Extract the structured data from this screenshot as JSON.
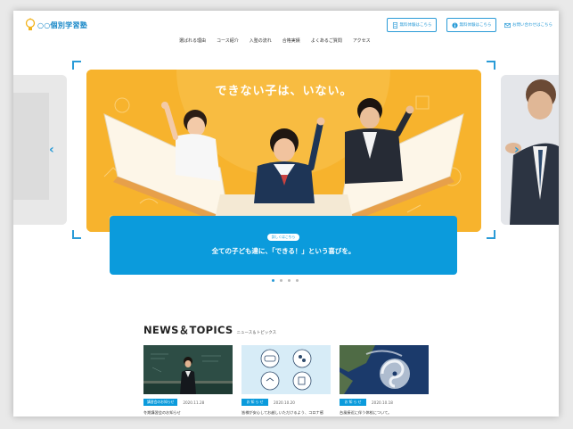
{
  "header": {
    "logo_text": "○○個別学習塾",
    "trial_button": "無料体験はこちら",
    "consult_button": "無料体験はこちら",
    "contact_link": "お問い合わせはこちら"
  },
  "nav": [
    {
      "label": "選ばれる理由"
    },
    {
      "label": "コース紹介"
    },
    {
      "label": "入塾の流れ"
    },
    {
      "label": "合格実績"
    },
    {
      "label": "よくあるご質問"
    },
    {
      "label": "アクセス"
    }
  ],
  "hero": {
    "headline": "できない子は、いない。",
    "pill": "詳しくはこちら",
    "caption": "全ての子ども達に、「できる！」という喜びを。"
  },
  "slider": {
    "dot_count": 4,
    "active_index": 0
  },
  "news": {
    "title": "NEWS＆TOPICS",
    "subtitle": "ニュース＆トピックス",
    "cards": [
      {
        "category": "講習会のお知らせ",
        "date": "2020.11.28",
        "title": "冬期講習会のお知らせ"
      },
      {
        "category": "お 知 ら せ",
        "date": "2020.10.20",
        "title": "皆様が安心してお越しいただけるよう、コロナ感"
      },
      {
        "category": "お 知 ら せ",
        "date": "2020.10.18",
        "title": "台風接近に伴う休校について。"
      }
    ]
  },
  "colors": {
    "accent": "#0b9bdc",
    "hero_bg": "#f7b32d"
  }
}
